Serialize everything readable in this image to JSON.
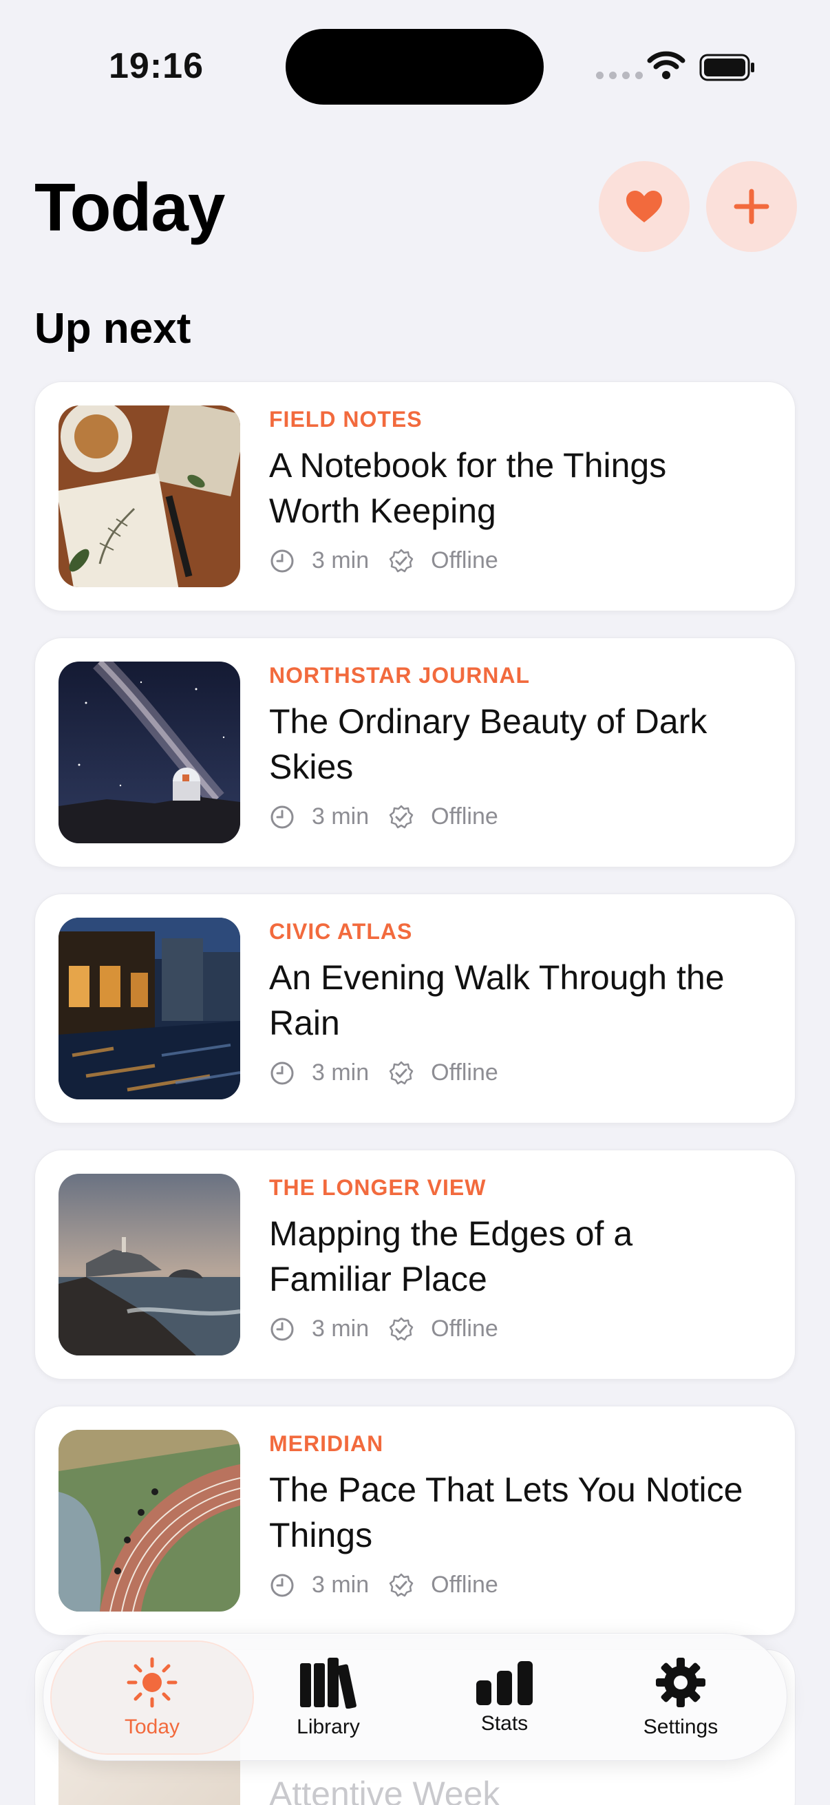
{
  "status": {
    "time": "19:16"
  },
  "header": {
    "title": "Today",
    "favorites_icon": "heart-icon",
    "add_icon": "plus-icon"
  },
  "section": {
    "title": "Up next"
  },
  "cards": [
    {
      "source": "FIELD NOTES",
      "title": "A Notebook for the Things Worth Keeping",
      "duration": "3 min",
      "status": "Offline"
    },
    {
      "source": "NORTHSTAR JOURNAL",
      "title": "The Ordinary Beauty of Dark Skies",
      "duration": "3 min",
      "status": "Offline"
    },
    {
      "source": "CIVIC ATLAS",
      "title": "An Evening Walk Through the Rain",
      "duration": "3 min",
      "status": "Offline"
    },
    {
      "source": "THE LONGER VIEW",
      "title": "Mapping the Edges of a Familiar Place",
      "duration": "3 min",
      "status": "Offline"
    },
    {
      "source": "MERIDIAN",
      "title": "The Pace That Lets You Notice Things",
      "duration": "3 min",
      "status": "Offline"
    }
  ],
  "peek_card": {
    "title": "Attentive Week"
  },
  "tabbar": {
    "tabs": [
      {
        "label": "Today",
        "icon": "sun-icon",
        "active": true
      },
      {
        "label": "Library",
        "icon": "books-icon",
        "active": false
      },
      {
        "label": "Stats",
        "icon": "bar-chart-icon",
        "active": false
      },
      {
        "label": "Settings",
        "icon": "gear-icon",
        "active": false
      }
    ]
  },
  "colors": {
    "accent": "#f26a3d",
    "background": "#f2f2f7",
    "button_bg": "#fbe0da"
  }
}
